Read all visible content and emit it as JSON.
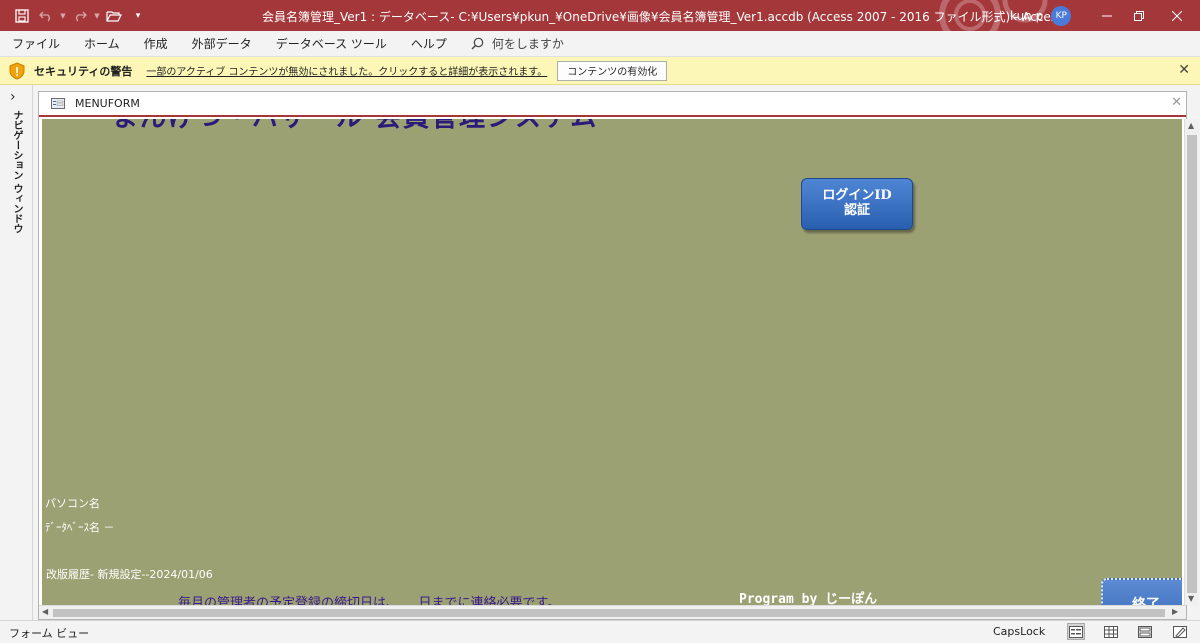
{
  "window": {
    "title": "会員名簿管理_Ver1 : データベース- C:¥Users¥pkun_¥OneDrive¥画像¥会員名簿管理_Ver1.accdb (Access 2007 - 2016 ファイル形式)  -  Access",
    "user_name": "kun p",
    "user_initials": "KP",
    "accent_color": "#a4373a"
  },
  "menu": {
    "items": [
      "ファイル",
      "ホーム",
      "作成",
      "外部データ",
      "データベース ツール",
      "ヘルプ"
    ],
    "tellme": "何をしますか"
  },
  "security": {
    "title": "セキュリティの警告",
    "message": "一部のアクティブ コンテンツが無効にされました。クリックすると詳細が表示されます。",
    "button": "コンテンツの有効化"
  },
  "nav_pane": {
    "label": "ナビゲーション ウィンドウ"
  },
  "document": {
    "tab_title": "MENUFORM"
  },
  "form": {
    "background": "#9ca173",
    "banner": "まんげつ・バザール 会員管理システム",
    "login_button": "ログインID\n認証",
    "pc_name_label": "パソコン名",
    "db_name_label": "ﾃﾞｰﾀﾍﾞｰｽ名 －",
    "revision": "改版履歴-  新規設定--2024/01/06",
    "notice": "毎月の管理者の予定登録の締切日は、　　日までに連絡必要です。",
    "credit": "Program by じーぽん",
    "exit_button": "終了"
  },
  "status": {
    "view_mode": "フォーム ビュー",
    "capslock": "CapsLock"
  }
}
